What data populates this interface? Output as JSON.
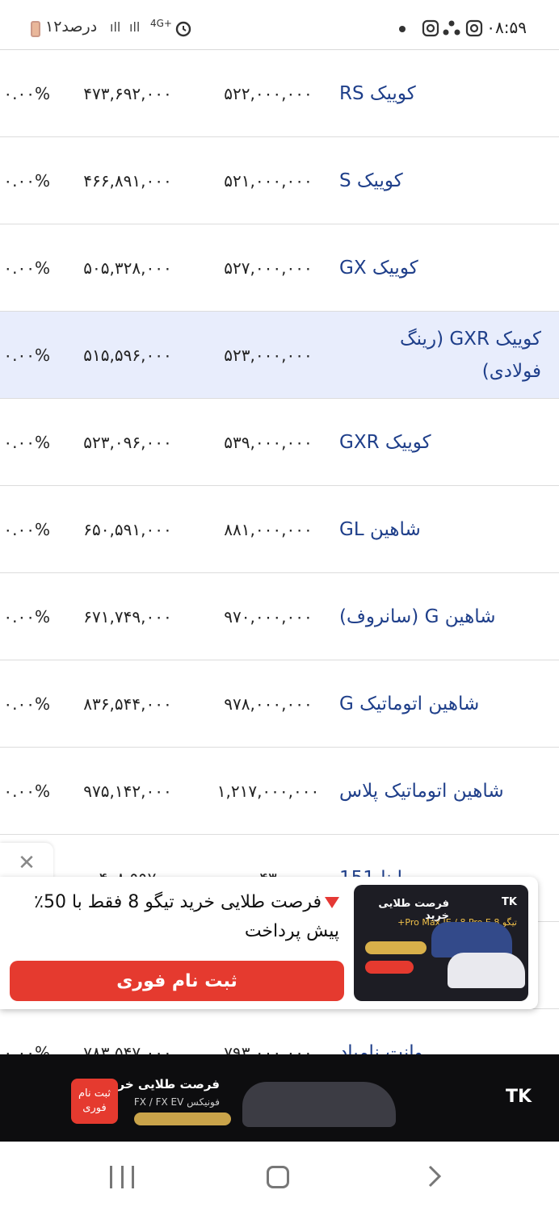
{
  "status_bar": {
    "time": "۰۸:۵۹",
    "battery_text": "۱۲درصد",
    "network": "4G+"
  },
  "rows": [
    {
      "name": "کوییک RS",
      "factory_price": "۵۲۲,۰۰۰,۰۰۰",
      "market_price": "۴۷۳,۶۹۲,۰۰۰",
      "change": "۰.۰۰%",
      "highlight": false
    },
    {
      "name": "کوییک S",
      "factory_price": "۵۲۱,۰۰۰,۰۰۰",
      "market_price": "۴۶۶,۸۹۱,۰۰۰",
      "change": "۰.۰۰%",
      "highlight": false
    },
    {
      "name": "کوییک GX",
      "factory_price": "۵۲۷,۰۰۰,۰۰۰",
      "market_price": "۵۰۵,۳۲۸,۰۰۰",
      "change": "۰.۰۰%",
      "highlight": false
    },
    {
      "name": "کوییک GXR (رینگ فولادی)",
      "factory_price": "۵۲۳,۰۰۰,۰۰۰",
      "market_price": "۵۱۵,۵۹۶,۰۰۰",
      "change": "۰.۰۰%",
      "highlight": true
    },
    {
      "name": "کوییک GXR",
      "factory_price": "۵۳۹,۰۰۰,۰۰۰",
      "market_price": "۵۲۳,۰۹۶,۰۰۰",
      "change": "۰.۰۰%",
      "highlight": false
    },
    {
      "name": "شاهین GL",
      "factory_price": "۸۸۱,۰۰۰,۰۰۰",
      "market_price": "۶۵۰,۵۹۱,۰۰۰",
      "change": "۰.۰۰%",
      "highlight": false
    },
    {
      "name": "شاهین G (سانروف)",
      "factory_price": "۹۷۰,۰۰۰,۰۰۰",
      "market_price": "۶۷۱,۷۴۹,۰۰۰",
      "change": "۰.۰۰%",
      "highlight": false
    },
    {
      "name": "شاهین اتوماتیک G",
      "factory_price": "۹۷۸,۰۰۰,۰۰۰",
      "market_price": "۸۳۶,۵۴۴,۰۰۰",
      "change": "۰.۰۰%",
      "highlight": false
    },
    {
      "name": "شاهین اتوماتیک پلاس",
      "factory_price": "۱,۲۱۷,۰۰۰,۰۰۰",
      "market_price": "۹۷۵,۱۴۲,۰۰۰",
      "change": "۰.۰۰%",
      "highlight": false
    },
    {
      "name": "ساینا 151",
      "factory_price": "۴۳",
      "market_price": "۴۰۸,۹۹۷",
      "change": "",
      "highlight": false
    },
    {
      "name": "",
      "factory_price": "",
      "market_price": "",
      "change": "",
      "highlight": false
    },
    {
      "name": "وانت نامیاد",
      "factory_price": "۷۹۳,۰۰۰,۰۰۰",
      "market_price": "۷۸۳,۵۴۷,۰۰۰",
      "change": "۰.۰۰%",
      "highlight": false
    }
  ],
  "popup": {
    "text": "فرصت طلایی خرید تیگو 8 فقط با 50٪ پیش پرداخت",
    "button": "ثبت نام فوری",
    "banner_title": "فرصت طلایی خرید",
    "banner_brand": "TK",
    "banner_model": "تیگو 8 Pro Max IE / 8 Pro E+"
  },
  "bottom_banner": {
    "brand": "TK",
    "title": "فرصت طلایی خرید",
    "subtitle": "فونیکس FX / FX EV",
    "cta": "ثبت نام فوری"
  },
  "colors": {
    "link_blue": "#1f3f8a",
    "highlight_row": "#e8edfc",
    "cta_red": "#e53a2f"
  }
}
